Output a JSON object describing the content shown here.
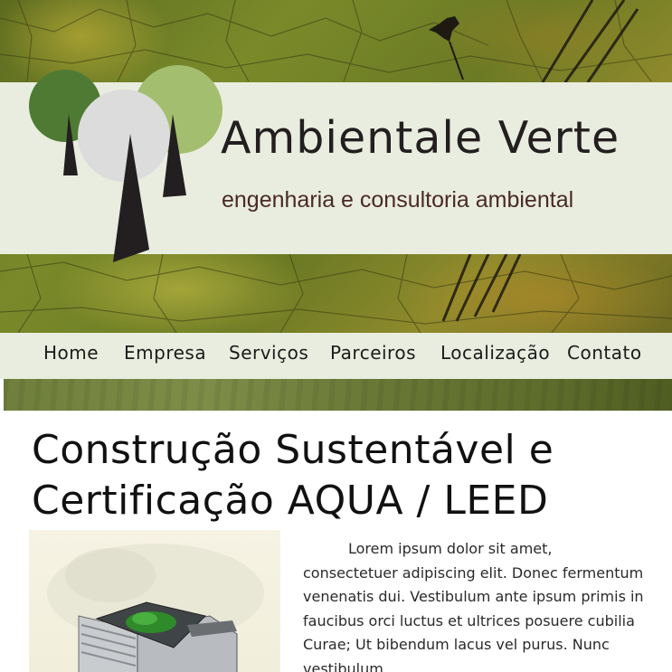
{
  "brand": {
    "name": "Ambientale Verte",
    "tagline": "engenharia e consultoria ambiental"
  },
  "nav": {
    "items": [
      {
        "label": "Home"
      },
      {
        "label": "Empresa"
      },
      {
        "label": "Serviços"
      },
      {
        "label": "Parceiros"
      },
      {
        "label": "Localização"
      },
      {
        "label": "Contato"
      }
    ]
  },
  "main": {
    "title": "Construção Sustentável e Certificação AQUA / LEED",
    "body": "Lorem ipsum dolor sit amet, consectetuer adipiscing elit. Donec fermentum venenatis dui. Vestibulum ante ipsum primis in faucibus orci luctus et ultrices posuere cubilia Curae; Ut bibendum lacus vel purus. Nunc vestibulum,"
  },
  "colors": {
    "band": "#e9eddf",
    "tree_dark_green": "#4f7a34",
    "tree_light_green": "#a3be6f",
    "tree_grey": "#dcdcdc",
    "trunk": "#231f20",
    "tagline": "#4a2a24"
  }
}
